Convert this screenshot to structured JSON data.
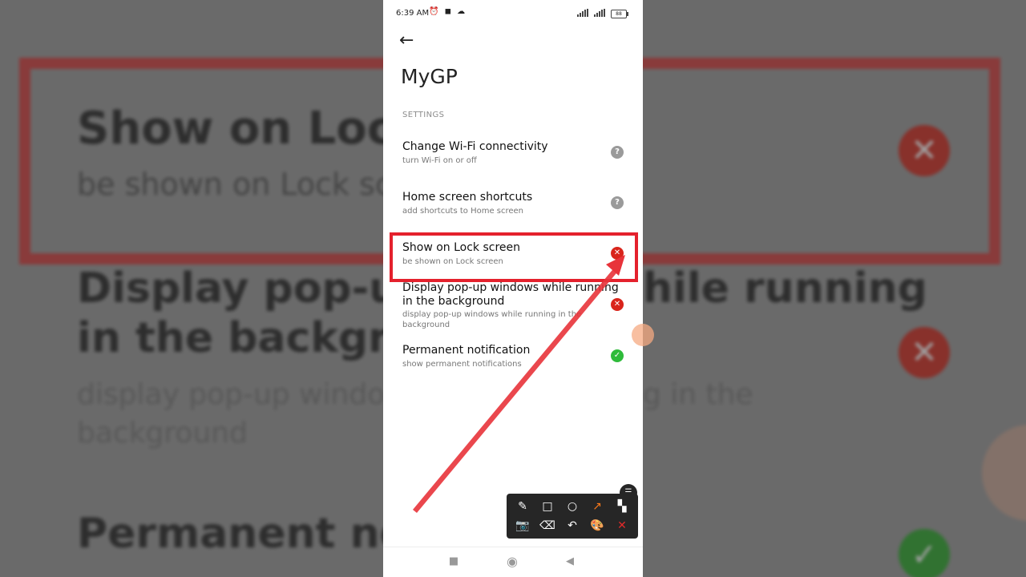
{
  "background": {
    "item1_title": "Show on Lock",
    "item1_sub": "be shown on Lock sc",
    "item2_title_a": "Display pop-up",
    "item2_title_b": "in the backgrou",
    "item2_title_c": "hile running",
    "item2_sub_a": "display pop-up windo",
    "item2_sub_b": "background",
    "item2_sub_c": "g in the",
    "item3_title": "Permanent not",
    "x_icon": "close-icon",
    "check_icon": "check-icon"
  },
  "status_bar": {
    "time": "6:39 AM",
    "icons": "⏰ ◼ ☁",
    "battery": "88"
  },
  "app": {
    "title": "MyGP",
    "section_label": "SETTINGS"
  },
  "settings": [
    {
      "title": "Change Wi-Fi connectivity",
      "subtitle": "turn Wi-Fi on or off",
      "status": "ask",
      "status_glyph": "?"
    },
    {
      "title": "Home screen shortcuts",
      "subtitle": "add shortcuts to Home screen",
      "status": "ask",
      "status_glyph": "?"
    },
    {
      "title": "Show on Lock screen",
      "subtitle": "be shown on Lock screen",
      "status": "denied",
      "status_glyph": "✕"
    },
    {
      "title_line1": "Display pop-up windows while running",
      "title_line2": "in the background",
      "subtitle_line1": "display pop-up windows while running in the",
      "subtitle_line2": "background",
      "status": "denied",
      "status_glyph": "✕"
    },
    {
      "title": "Permanent notification",
      "subtitle": "show permanent notifications",
      "status": "allowed",
      "status_glyph": "✓"
    }
  ],
  "annotation_toolbar": {
    "tools": [
      "brush-icon",
      "rectangle-icon",
      "circle-icon",
      "arrow-icon",
      "mosaic-icon",
      "camera-icon",
      "eraser-icon",
      "undo-icon",
      "palette-icon",
      "close-icon"
    ],
    "glyphs": [
      "✎",
      "□",
      "○",
      "↗",
      "▚",
      "📷",
      "⌫",
      "↶",
      "🎨",
      "✕"
    ]
  },
  "nav_bar": {
    "recents": "■",
    "home": "◉",
    "back": "◀"
  },
  "colors": {
    "highlight": "#e4212d",
    "denied": "#d9241b",
    "allowed": "#2ebb3a",
    "ask": "#9a9a9a"
  }
}
